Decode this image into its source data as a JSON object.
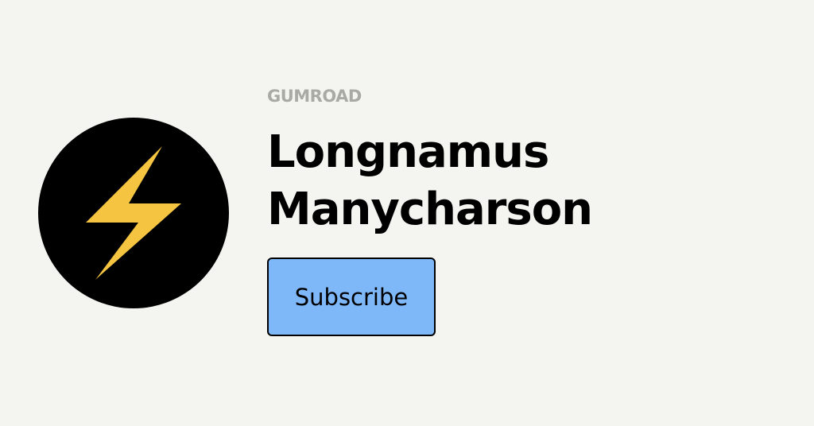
{
  "brand": {
    "logo_text": "GUMROAD",
    "color": "#a9a9a6"
  },
  "profile": {
    "name_line1": "Longnamus",
    "name_line2": "Manycharson",
    "avatar_icon": "lightning-bolt-icon",
    "avatar_background": "#000000",
    "icon_color": "#f5c542"
  },
  "actions": {
    "subscribe_label": "Subscribe",
    "subscribe_color": "#7fb8f8"
  },
  "page": {
    "background": "#f4f4f0"
  }
}
